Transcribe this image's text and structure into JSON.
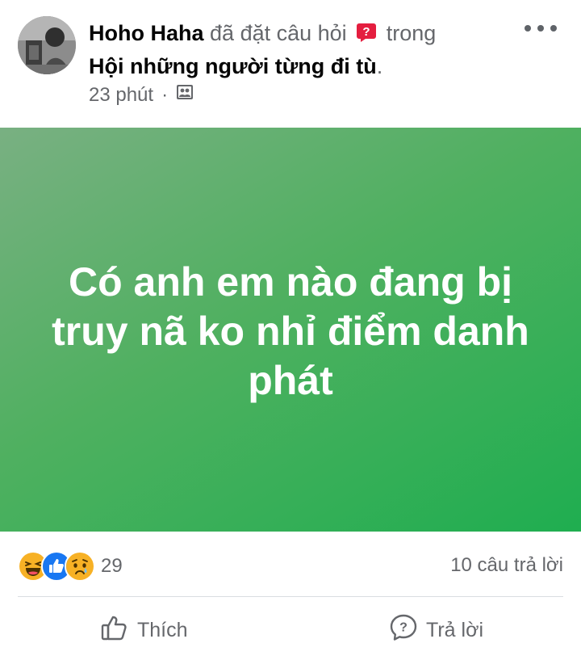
{
  "post": {
    "author": "Hoho Haha",
    "action_text": "đã đặt câu hỏi",
    "trong": "trong",
    "group_name": "Hội những người từng đi tù",
    "group_dot": ".",
    "time": "23 phút",
    "separator": "·",
    "question_text": "Có anh em nào đang bị truy nã ko nhỉ điểm danh phát",
    "banner_colors": [
      "#79b082",
      "#1fae50"
    ],
    "icons": {
      "question": "question-badge-icon",
      "privacy": "group-privacy-icon",
      "more": "more-options-icon"
    }
  },
  "stats": {
    "reactions": [
      "haha-reaction",
      "like-reaction",
      "sad-reaction"
    ],
    "reaction_count": "29",
    "answer_count": "10 câu trả lời"
  },
  "actions": {
    "like_label": "Thích",
    "reply_label": "Trả lời"
  },
  "colors": {
    "text_primary": "#050505",
    "text_secondary": "#65676b",
    "like_blue": "#1877f2",
    "question_red": "#e41e3f"
  }
}
